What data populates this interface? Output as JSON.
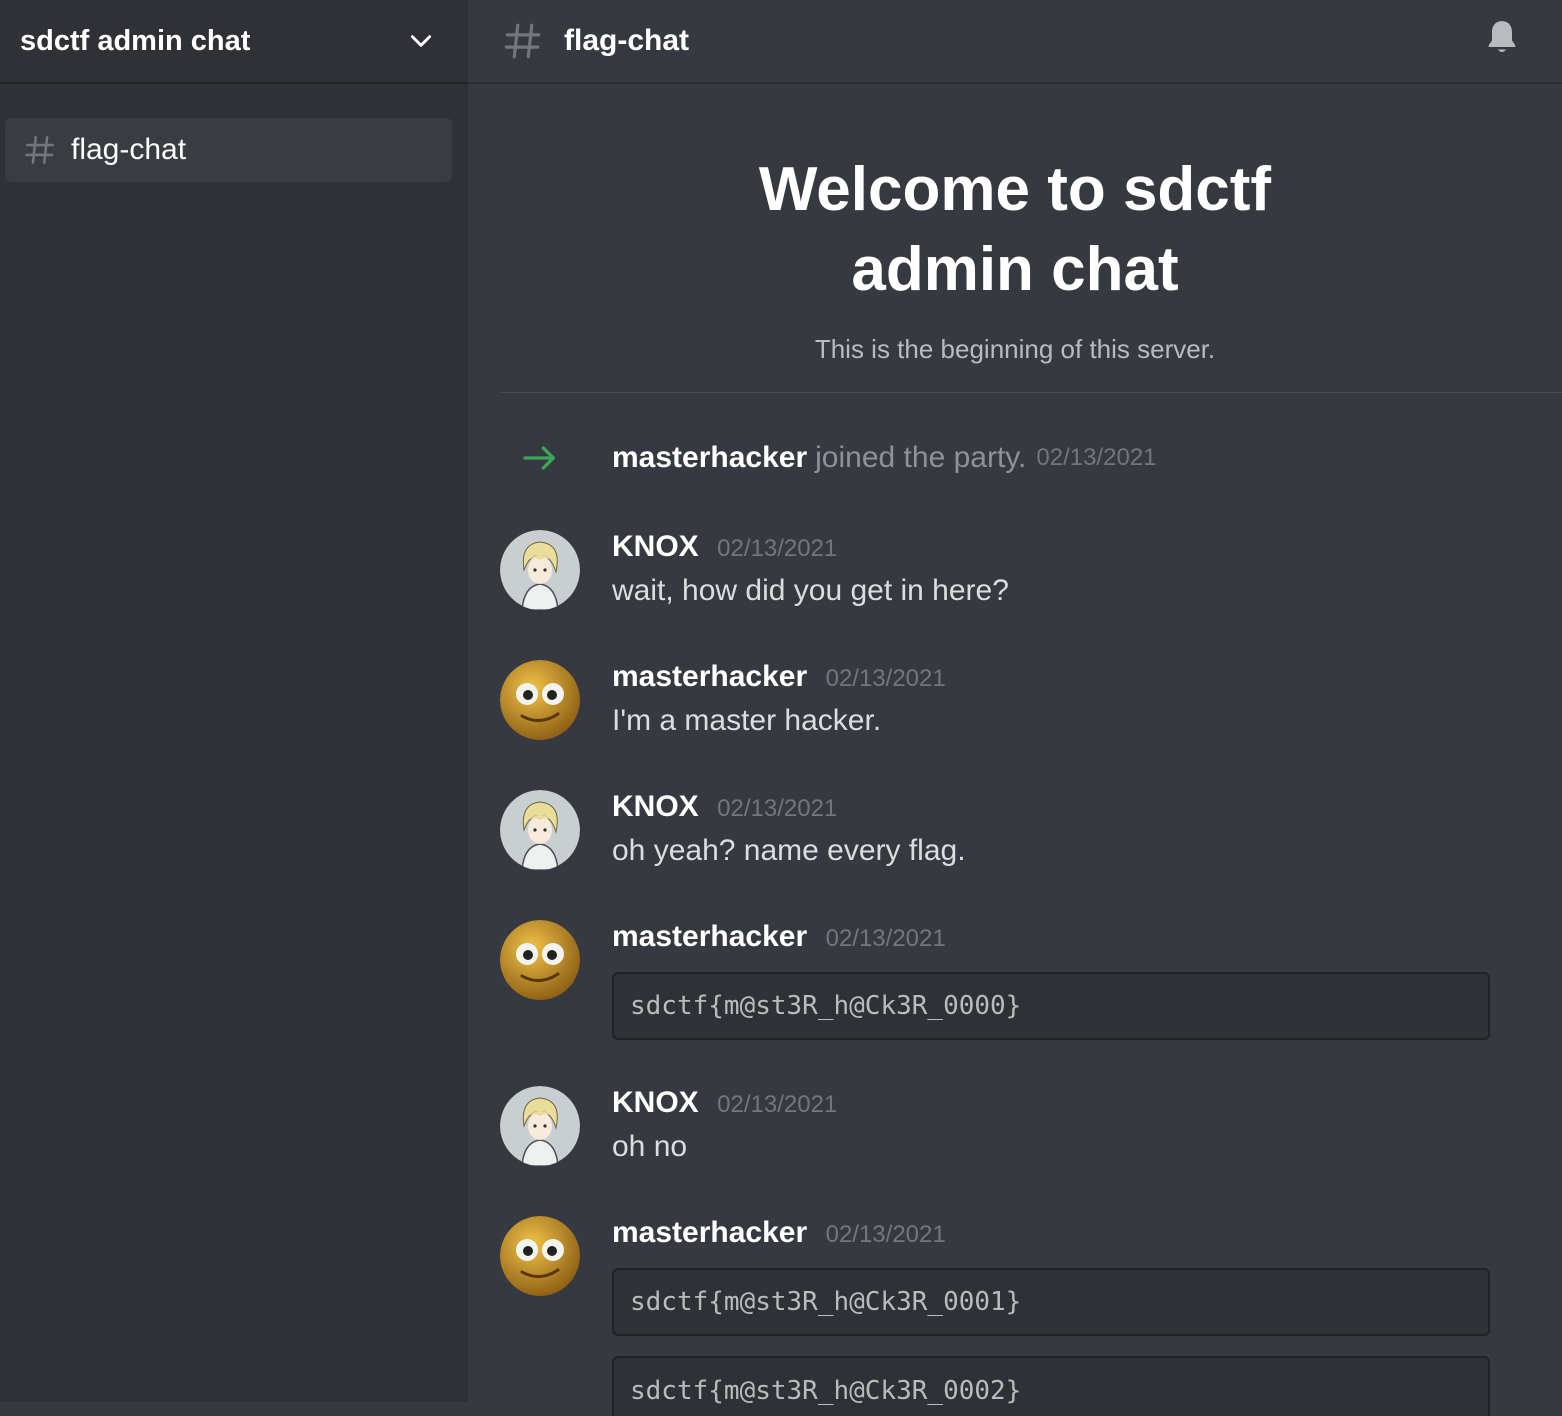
{
  "sidebar": {
    "server_name": "sdctf admin chat",
    "channels": [
      {
        "label": "flag-chat"
      }
    ]
  },
  "header": {
    "channel_title": "flag-chat"
  },
  "welcome": {
    "title": "Welcome to sdctf admin chat",
    "subtitle": "This is the beginning of this server."
  },
  "join_event": {
    "user": "masterhacker",
    "text": "joined the party.",
    "timestamp": "02/13/2021"
  },
  "messages": [
    {
      "author": "KNOX",
      "timestamp": "02/13/2021",
      "text": "wait, how did you get in here?"
    },
    {
      "author": "masterhacker",
      "timestamp": "02/13/2021",
      "text": "I'm a master hacker."
    },
    {
      "author": "KNOX",
      "timestamp": "02/13/2021",
      "text": "oh yeah? name every flag."
    },
    {
      "author": "masterhacker",
      "timestamp": "02/13/2021",
      "code": [
        "sdctf{m@st3R_h@Ck3R_0000}"
      ]
    },
    {
      "author": "KNOX",
      "timestamp": "02/13/2021",
      "text": "oh no"
    },
    {
      "author": "masterhacker",
      "timestamp": "02/13/2021",
      "code": [
        "sdctf{m@st3R_h@Ck3R_0001}",
        "sdctf{m@st3R_h@Ck3R_0002}"
      ]
    }
  ],
  "icons": {
    "chevron": "chevron-down-icon",
    "hash": "hash-icon",
    "bell": "bell-icon",
    "arrow": "join-arrow-icon"
  },
  "colors": {
    "background": "#36393f",
    "sidebar": "#2f3136",
    "join_arrow": "#3ba55c"
  }
}
